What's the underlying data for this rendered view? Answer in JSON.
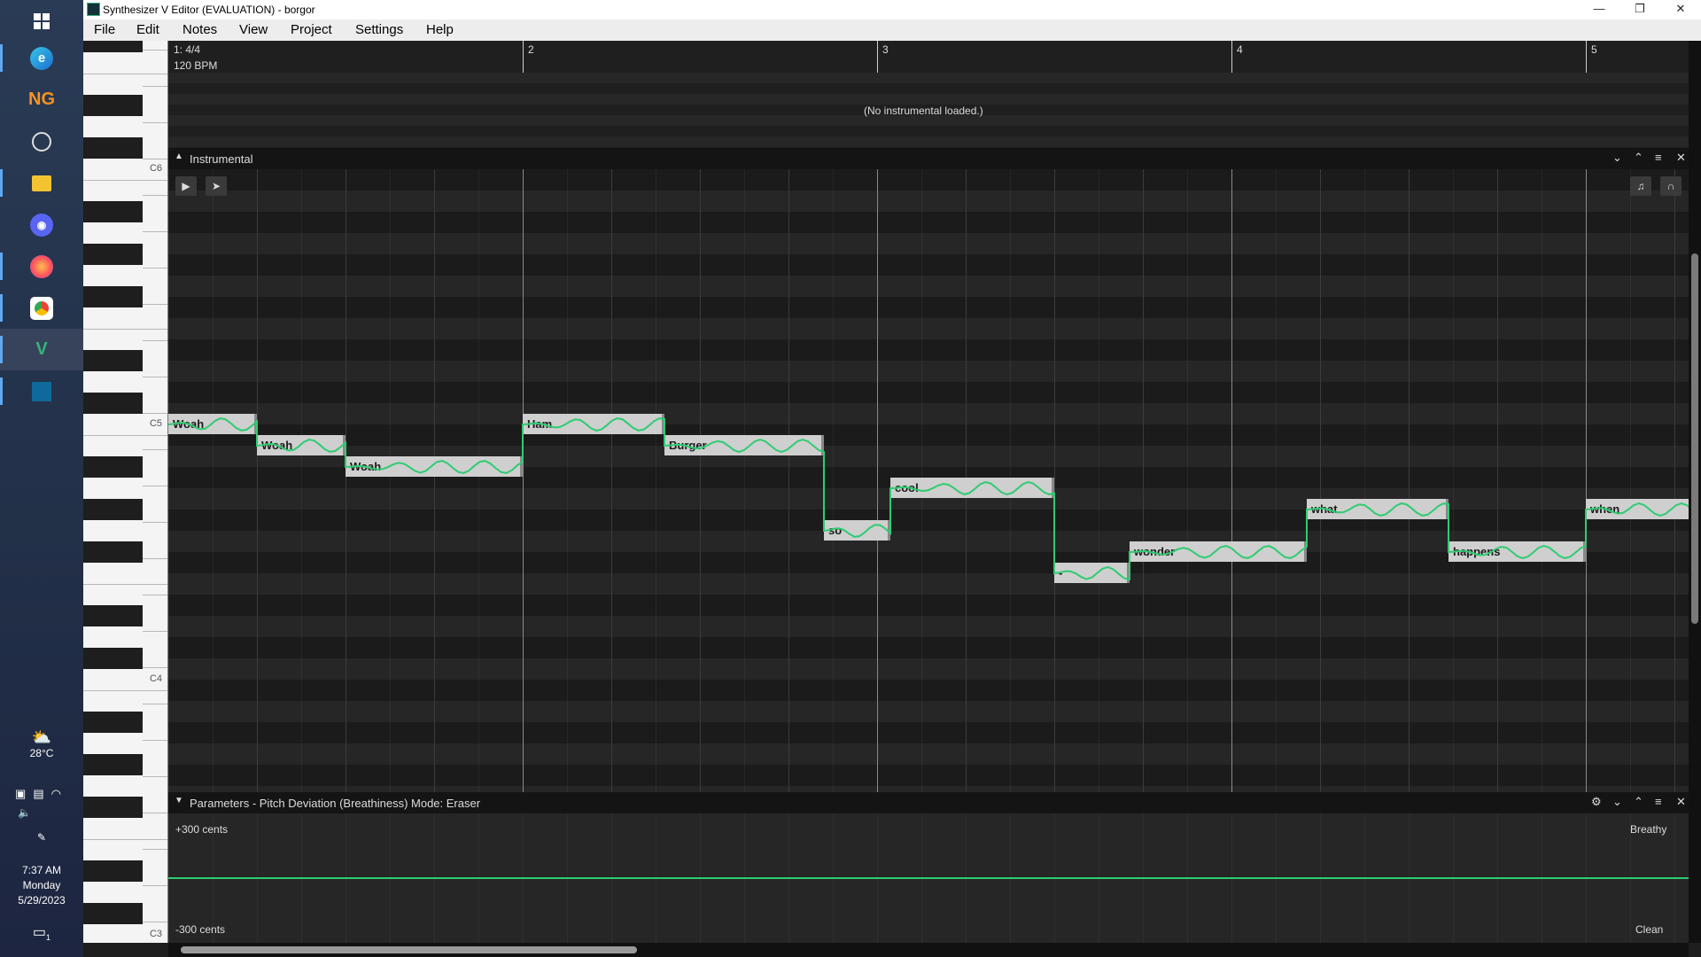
{
  "window": {
    "title": "Synthesizer V Editor (EVALUATION) - borgor",
    "controls": [
      "—",
      "❐",
      "✕"
    ]
  },
  "menu": [
    "File",
    "Edit",
    "Notes",
    "View",
    "Project",
    "Settings",
    "Help"
  ],
  "taskbar": {
    "weather": "28°C",
    "time": "7:37 AM",
    "day": "Monday",
    "date": "5/29/2023",
    "notification_count": "1"
  },
  "piano": {
    "labels": [
      "C6",
      "C5",
      "C4",
      "C3"
    ]
  },
  "header": {
    "time_signature": "1: 4/4",
    "tempo": "120 BPM",
    "bars": [
      "2",
      "3",
      "4",
      "5"
    ],
    "message": "(No instrumental loaded.)"
  },
  "instrumental_panel": {
    "label": "Instrumental"
  },
  "notes": [
    {
      "lyric": "Woah",
      "start": 0,
      "length": 1.0,
      "pitch": 0
    },
    {
      "lyric": "Woah",
      "start": 1.0,
      "length": 1.0,
      "pitch": -1
    },
    {
      "lyric": "Woah",
      "start": 2.0,
      "length": 2.0,
      "pitch": -2
    },
    {
      "lyric": "Ham",
      "start": 4.0,
      "length": 1.6,
      "pitch": 0
    },
    {
      "lyric": "Burger",
      "start": 5.6,
      "length": 1.8,
      "pitch": -1
    },
    {
      "lyric": "so",
      "start": 7.4,
      "length": 0.75,
      "pitch": -5
    },
    {
      "lyric": "cool",
      "start": 8.15,
      "length": 1.85,
      "pitch": -3
    },
    {
      "lyric": "-",
      "start": 10.0,
      "length": 0.85,
      "pitch": -7
    },
    {
      "lyric": "wonder",
      "start": 10.85,
      "length": 2.0,
      "pitch": -6
    },
    {
      "lyric": "what",
      "start": 12.85,
      "length": 1.6,
      "pitch": -4
    },
    {
      "lyric": "happens",
      "start": 14.45,
      "length": 1.55,
      "pitch": -6
    },
    {
      "lyric": "when",
      "start": 16.0,
      "length": 1.2,
      "pitch": -4
    }
  ],
  "params_panel": {
    "label": "Parameters",
    "mode": "Pitch Deviation (Breathiness) Mode: Eraser",
    "top_value": "+300 cents",
    "bottom_value": "-300 cents",
    "top_right": "Breathy",
    "bottom_right": "Clean"
  },
  "colors": {
    "accent": "#2ecc71",
    "note_fill": "#cfcfcf",
    "background": "#262626"
  }
}
